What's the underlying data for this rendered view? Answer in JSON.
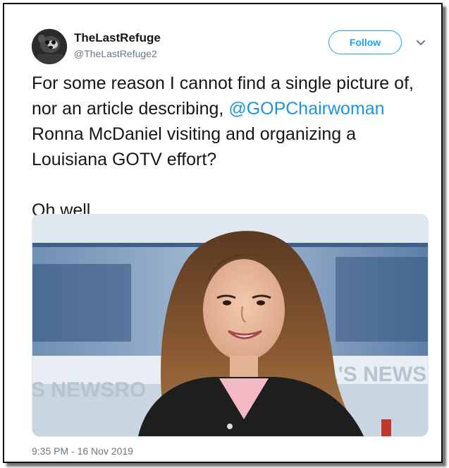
{
  "tweet": {
    "display_name": "TheLastRefuge",
    "handle": "@TheLastRefuge2",
    "follow_label": "Follow",
    "text_before_mention": "For some reason I cannot find a single picture of, nor an article describing, ",
    "mention": "@GOPChairwoman",
    "text_after_mention": " Ronna McDaniel visiting and organizing a Louisiana GOTV effort?",
    "text_second_paragraph": "Oh well...",
    "timestamp": "9:35 PM - 16 Nov 2019"
  },
  "media": {
    "background_text_left": "S NEWSRO",
    "background_text_right": "A'S NEWS"
  },
  "icons": {
    "avatar": "avatar-image",
    "more": "chevron-down-icon"
  },
  "colors": {
    "accent": "#1da1f2",
    "mention": "#1b95e0",
    "text": "#14171a",
    "secondary": "#657786"
  }
}
